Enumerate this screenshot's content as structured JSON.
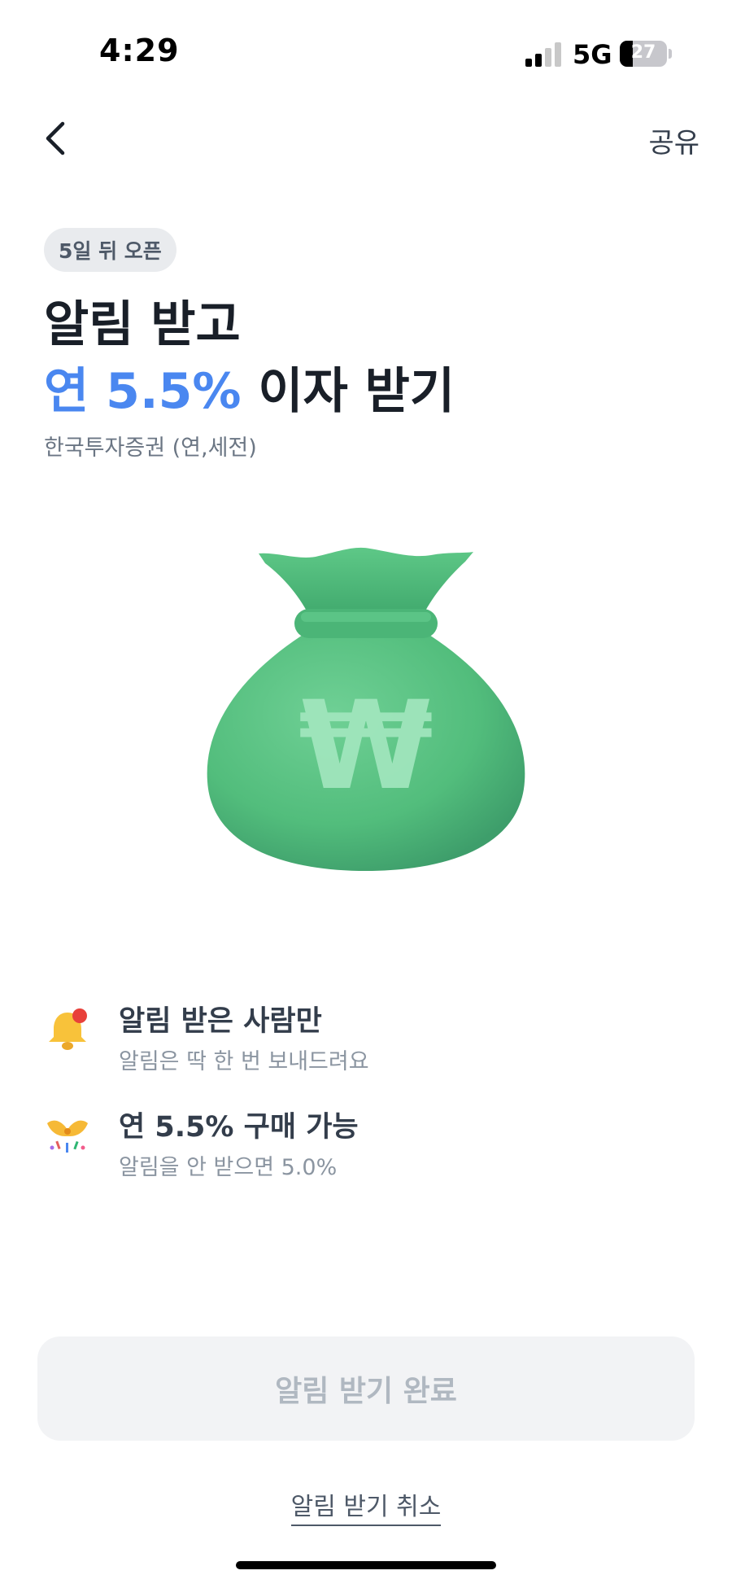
{
  "status_bar": {
    "time": "4:29",
    "network": "5G",
    "battery_level": "27"
  },
  "nav": {
    "back_icon": "chevron-left-icon",
    "share_label": "공유"
  },
  "hero": {
    "badge": "5일 뒤 오픈",
    "title_line1": "알림 받고",
    "title_rate": "연 5.5%",
    "title_rest": " 이자 받기",
    "provider": "한국투자증권 (연,세전)",
    "image_icon": "money-bag-icon",
    "image_symbol": "₩"
  },
  "benefits": [
    {
      "icon": "bell-icon",
      "title": "알림 받은 사람만",
      "subtitle": "알림은 딱 한 번 보내드려요"
    },
    {
      "icon": "party-popper-icon",
      "title": "연 5.5% 구매 가능",
      "subtitle": "알림을 안 받으면 5.0%"
    }
  ],
  "actions": {
    "primary_label": "알림 받기 완료",
    "cancel_label": "알림 받기 취소"
  },
  "colors": {
    "accent": "#4a87f0",
    "bag_green": "#55c07f",
    "button_bg": "#f2f3f5",
    "button_text": "#b0b8c1"
  }
}
